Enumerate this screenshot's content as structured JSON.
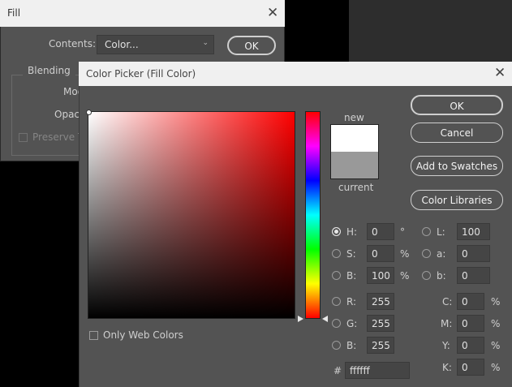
{
  "fill_dialog": {
    "title": "Fill",
    "close": "✕",
    "contents_label": "Contents:",
    "contents_value": "Color...",
    "ok": "OK",
    "blending_label": "Blending",
    "mode_label": "Mod",
    "opacity_label": "Opac",
    "preserve_label": "Preserve T"
  },
  "picker": {
    "title": "Color Picker (Fill Color)",
    "close": "✕",
    "new_label": "new",
    "current_label": "current",
    "new_color": "#ffffff",
    "current_color": "#999999",
    "buttons": {
      "ok": "OK",
      "cancel": "Cancel",
      "add_swatches": "Add to Swatches",
      "libraries": "Color Libraries"
    },
    "only_web": "Only Web Colors",
    "hsb": {
      "h_label": "H:",
      "h_value": "0",
      "h_unit": "°",
      "s_label": "S:",
      "s_value": "0",
      "s_unit": "%",
      "b_label": "B:",
      "b_value": "100",
      "b_unit": "%"
    },
    "lab": {
      "l_label": "L:",
      "l_value": "100",
      "a_label": "a:",
      "a_value": "0",
      "b_label": "b:",
      "b_value": "0"
    },
    "rgb": {
      "r_label": "R:",
      "r_value": "255",
      "g_label": "G:",
      "g_value": "255",
      "b_label": "B:",
      "b_value": "255"
    },
    "cmyk": {
      "c_label": "C:",
      "c_value": "0",
      "m_label": "M:",
      "m_value": "0",
      "y_label": "Y:",
      "y_value": "0",
      "k_label": "K:",
      "k_value": "0",
      "unit": "%"
    },
    "hex_label": "#",
    "hex_value": "ffffff"
  }
}
